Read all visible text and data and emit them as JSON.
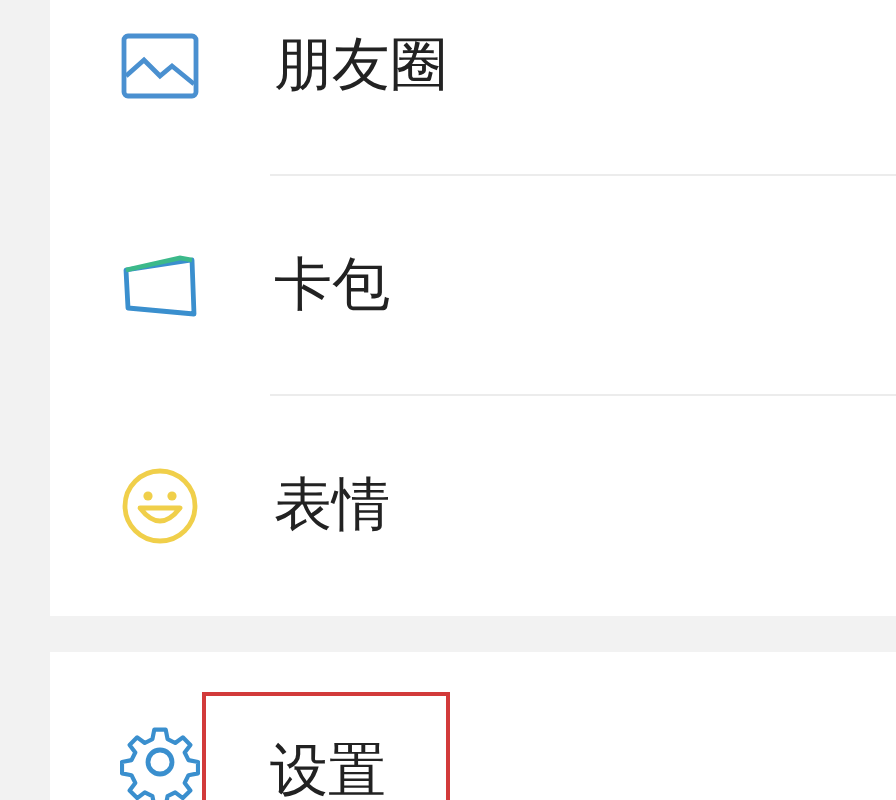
{
  "sections": [
    {
      "items": [
        {
          "kind": "moments",
          "label": "朋友圈",
          "highlighted": false
        },
        {
          "kind": "cards",
          "label": "卡包",
          "highlighted": false
        },
        {
          "kind": "stickers",
          "label": "表情",
          "highlighted": false
        }
      ]
    },
    {
      "items": [
        {
          "kind": "settings",
          "label": "设置",
          "highlighted": true
        }
      ]
    }
  ]
}
